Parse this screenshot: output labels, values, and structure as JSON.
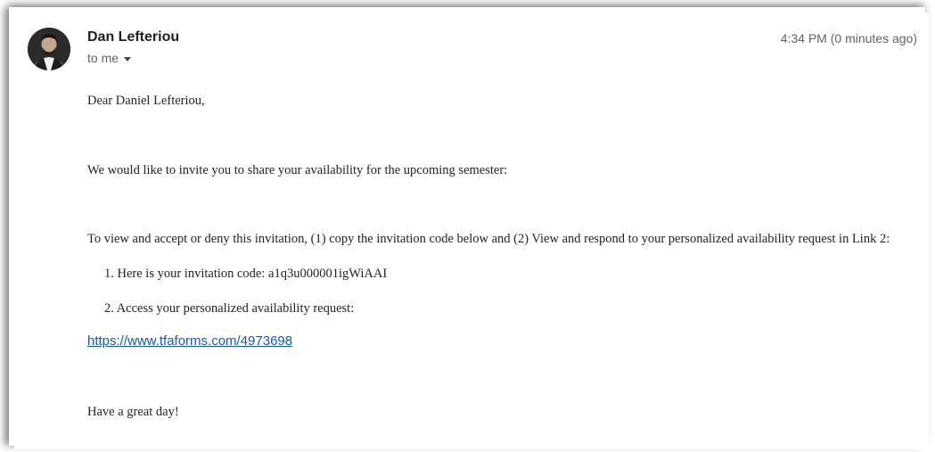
{
  "email": {
    "sender_name": "Dan Lefteriou",
    "recipient_label": "to me",
    "timestamp": "4:34 PM (0 minutes ago)",
    "greeting": "Dear Daniel Lefteriou,",
    "paragraph_1": "We would like to invite you to share your availability for the upcoming semester:",
    "paragraph_2": "To view and accept or deny this invitation, (1) copy the invitation code below and (2) View and respond to your personalized availability request in Link 2:",
    "steps": [
      "1. Here is your invitation code: a1q3u000001igWiAAI",
      "2. Access your personalized availability request:"
    ],
    "link_url": "https://www.tfaforms.com/4973698",
    "closing": "Have a great day!"
  },
  "icons": {
    "recipient_dropdown": "caret-down-icon",
    "avatar": "sender-avatar"
  },
  "colors": {
    "link": "#1155cc",
    "secondary_text": "#5f6368",
    "primary_text": "#1f1f1f"
  }
}
